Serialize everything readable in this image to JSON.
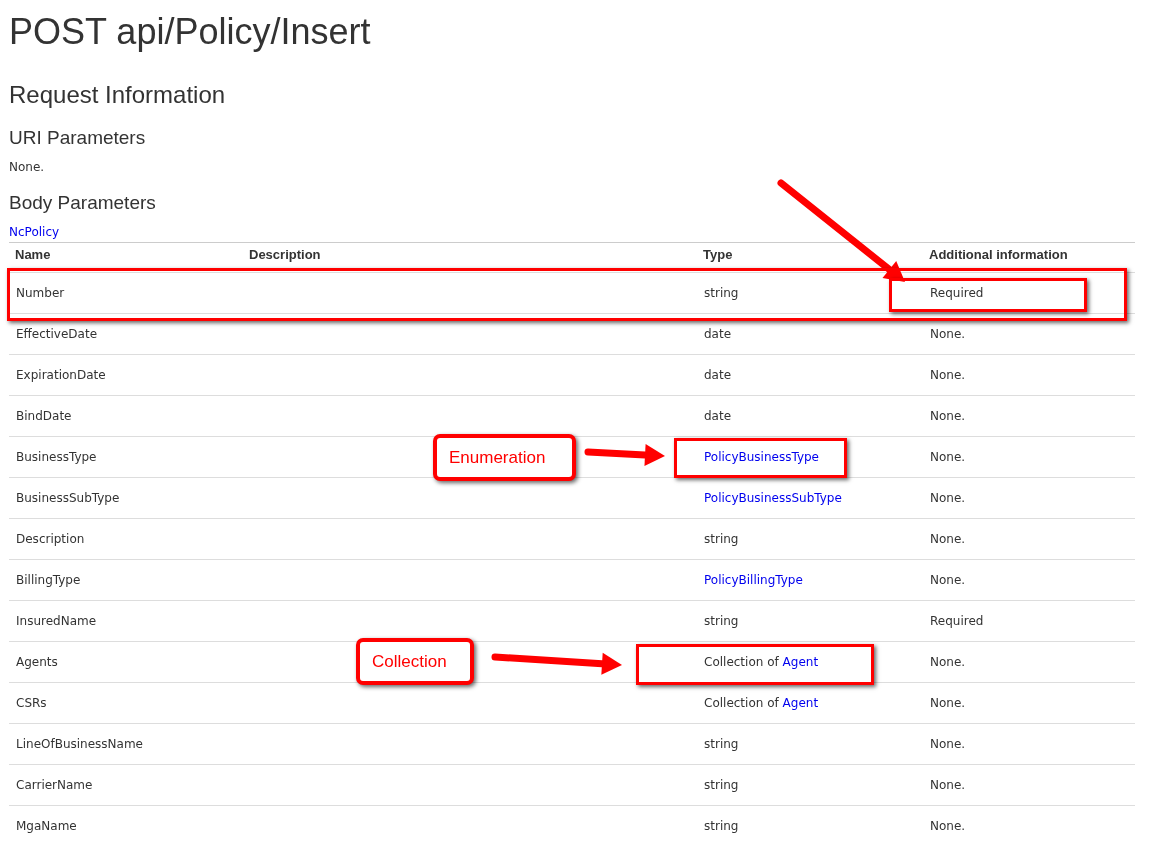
{
  "title": "POST api/Policy/Insert",
  "section": "Request Information",
  "uri_parameters": {
    "heading": "URI Parameters",
    "text": "None."
  },
  "body_parameters": {
    "heading": "Body Parameters",
    "type_link": "NcPolicy",
    "table": {
      "columns": [
        "Name",
        "Description",
        "Type",
        "Additional information"
      ],
      "rows": [
        {
          "name": "Number",
          "type": {
            "kind": "plain",
            "text": "string"
          },
          "info": "Required"
        },
        {
          "name": "EffectiveDate",
          "type": {
            "kind": "plain",
            "text": "date"
          },
          "info": "None."
        },
        {
          "name": "ExpirationDate",
          "type": {
            "kind": "plain",
            "text": "date"
          },
          "info": "None."
        },
        {
          "name": "BindDate",
          "type": {
            "kind": "plain",
            "text": "date"
          },
          "info": "None."
        },
        {
          "name": "BusinessType",
          "type": {
            "kind": "link",
            "text": "PolicyBusinessType"
          },
          "info": "None."
        },
        {
          "name": "BusinessSubType",
          "type": {
            "kind": "link",
            "text": "PolicyBusinessSubType"
          },
          "info": "None."
        },
        {
          "name": "Description",
          "type": {
            "kind": "plain",
            "text": "string"
          },
          "info": "None."
        },
        {
          "name": "BillingType",
          "type": {
            "kind": "link",
            "text": "PolicyBillingType"
          },
          "info": "None."
        },
        {
          "name": "InsuredName",
          "type": {
            "kind": "plain",
            "text": "string"
          },
          "info": "Required"
        },
        {
          "name": "Agents",
          "type": {
            "kind": "collection",
            "prefix": "Collection of",
            "text": "Agent"
          },
          "info": "None."
        },
        {
          "name": "CSRs",
          "type": {
            "kind": "collection",
            "prefix": "Collection of",
            "text": "Agent"
          },
          "info": "None."
        },
        {
          "name": "LineOfBusinessName",
          "type": {
            "kind": "plain",
            "text": "string"
          },
          "info": "None."
        },
        {
          "name": "CarrierName",
          "type": {
            "kind": "plain",
            "text": "string"
          },
          "info": "None."
        },
        {
          "name": "MgaName",
          "type": {
            "kind": "plain",
            "text": "string"
          },
          "info": "None."
        }
      ]
    }
  },
  "annotations": [
    {
      "kind": "callout",
      "text": "Enumeration"
    },
    {
      "kind": "callout",
      "text": "Collection"
    }
  ]
}
